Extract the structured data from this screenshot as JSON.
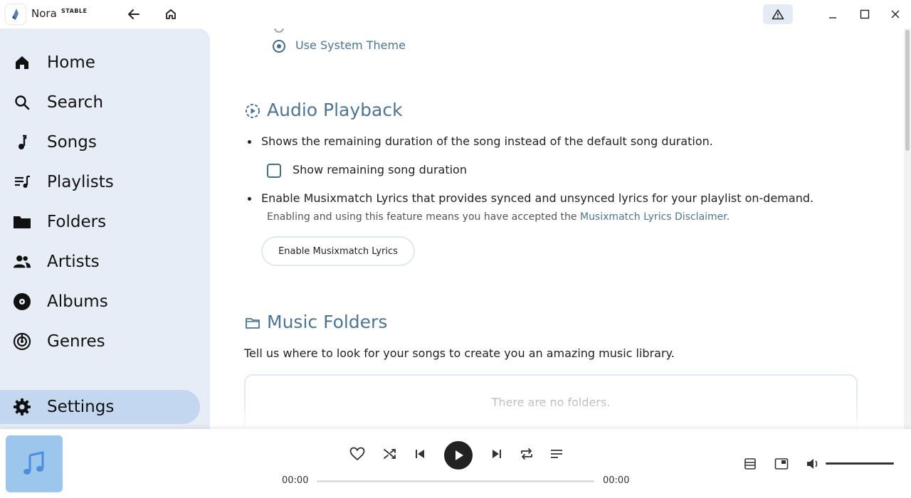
{
  "app": {
    "name": "Nora",
    "badge": "STABLE"
  },
  "sidebar": {
    "items": [
      {
        "label": "Home",
        "icon": "home-icon"
      },
      {
        "label": "Search",
        "icon": "search-icon"
      },
      {
        "label": "Songs",
        "icon": "music-note-icon"
      },
      {
        "label": "Playlists",
        "icon": "playlist-icon"
      },
      {
        "label": "Folders",
        "icon": "folder-icon"
      },
      {
        "label": "Artists",
        "icon": "people-icon"
      },
      {
        "label": "Albums",
        "icon": "album-icon"
      },
      {
        "label": "Genres",
        "icon": "genre-icon"
      }
    ],
    "settings": {
      "label": "Settings",
      "icon": "gear-icon",
      "active": true
    }
  },
  "theme": {
    "system_theme_label": "Use System Theme"
  },
  "audio_playback": {
    "title": "Audio Playback",
    "remaining_desc": "Shows the remaining duration of the song instead of the default song duration.",
    "remaining_checkbox_label": "Show remaining song duration",
    "musixmatch_desc": "Enable Musixmatch Lyrics that provides synced and unsynced lyrics for your playlist on-demand.",
    "disclaimer_prefix": "Enabling and using this feature means you have accepted the ",
    "disclaimer_link": "Musixmatch Lyrics Disclaimer",
    "disclaimer_suffix": ".",
    "enable_button": "Enable Musixmatch Lyrics"
  },
  "music_folders": {
    "title": "Music Folders",
    "desc": "Tell us where to look for your songs to create you an amazing music library.",
    "empty": "There are no folders."
  },
  "player": {
    "current_time": "00:00",
    "total_time": "00:00",
    "progress": 0
  },
  "colors": {
    "accent": "#4b7596",
    "sidebar_bg": "#e7edf6",
    "active_bg": "#c3d7f0"
  }
}
